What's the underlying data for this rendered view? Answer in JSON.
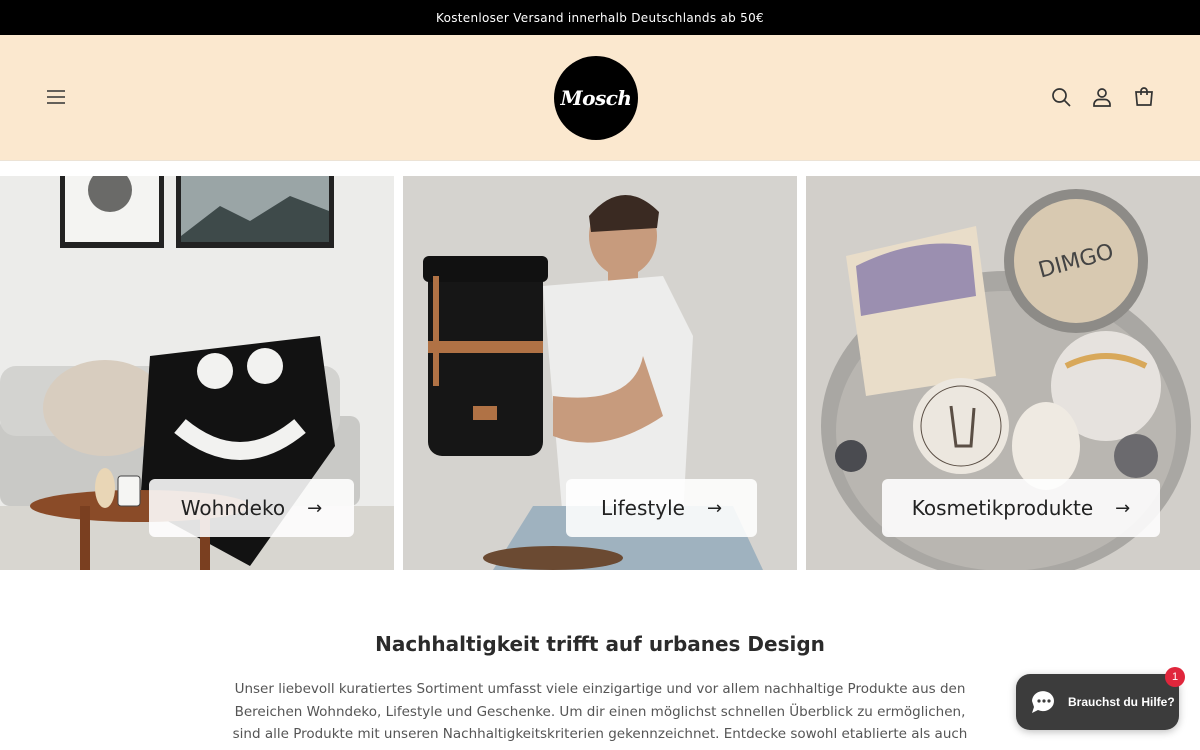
{
  "announcement": "Kostenloser Versand innerhalb Deutschlands ab 50€",
  "header": {
    "logo_text": "Mosch",
    "icons": [
      "menu-icon",
      "search-icon",
      "account-icon",
      "cart-icon"
    ]
  },
  "categories": [
    {
      "label": "Wohndeko",
      "arrow": "→"
    },
    {
      "label": "Lifestyle",
      "arrow": "→"
    },
    {
      "label": "Kosmetikprodukte",
      "arrow": "→"
    }
  ],
  "intro": {
    "title": "Nachhaltigkeit trifft auf urbanes Design",
    "text": "Unser liebevoll kuratiertes Sortiment umfasst viele einzigartige und vor allem nachhaltige Produkte aus den Bereichen Wohndeko, Lifestyle und Geschenke. Um dir einen möglichst schnellen Überblick zu ermöglichen, sind alle Produkte mit unseren Nachhaltigkeitskriterien gekennzeichnet. Entdecke sowohl etablierte als auch kleine, aber"
  },
  "chat": {
    "label": "Brauchst du Hilfe?",
    "badge": "1"
  },
  "colors": {
    "header_bg": "#fbe8cf",
    "announcement_bg": "#000000",
    "chat_bg": "#3c3c3c",
    "badge": "#e0263c"
  }
}
